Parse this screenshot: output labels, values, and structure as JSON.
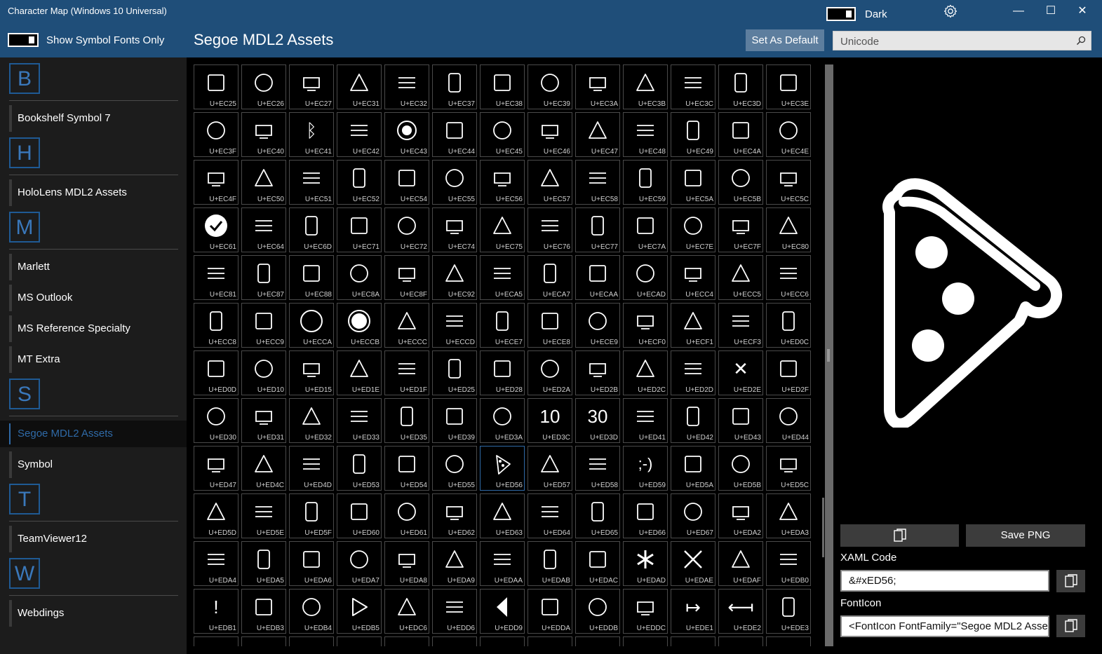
{
  "window": {
    "title": "Character Map (Windows 10 Universal)",
    "minimize": "—",
    "maximize": "☐",
    "close": "✕"
  },
  "theme": {
    "label": "Dark"
  },
  "toolbar": {
    "symbol_toggle_label": "Show Symbol Fonts Only",
    "current_font": "Segoe MDL2 Assets",
    "set_default_label": "Set As Default",
    "search_placeholder": "Unicode"
  },
  "sidebar": {
    "groups": [
      {
        "letter": "B",
        "fonts": [
          "Bookshelf Symbol 7"
        ]
      },
      {
        "letter": "H",
        "fonts": [
          "HoloLens MDL2 Assets"
        ]
      },
      {
        "letter": "M",
        "fonts": [
          "Marlett",
          "MS Outlook",
          "MS Reference Specialty",
          "MT Extra"
        ]
      },
      {
        "letter": "S",
        "fonts": [
          "Segoe MDL2 Assets",
          "Symbol"
        ]
      },
      {
        "letter": "T",
        "fonts": [
          "TeamViewer12"
        ]
      },
      {
        "letter": "W",
        "fonts": [
          "Webdings"
        ]
      }
    ],
    "selected_font": "Segoe MDL2 Assets"
  },
  "grid": {
    "selected_code": "U+ED56",
    "cells": [
      "U+EC25",
      "U+EC26",
      "U+EC27",
      "U+EC31",
      "U+EC32",
      "U+EC37",
      "U+EC38",
      "U+EC39",
      "U+EC3A",
      "U+EC3B",
      "U+EC3C",
      "U+EC3D",
      "U+EC3E",
      "U+EC3F",
      "U+EC40",
      "U+EC41",
      "U+EC42",
      "U+EC43",
      "U+EC44",
      "U+EC45",
      "U+EC46",
      "U+EC47",
      "U+EC48",
      "U+EC49",
      "U+EC4A",
      "U+EC4E",
      "U+EC4F",
      "U+EC50",
      "U+EC51",
      "U+EC52",
      "U+EC54",
      "U+EC55",
      "U+EC56",
      "U+EC57",
      "U+EC58",
      "U+EC59",
      "U+EC5A",
      "U+EC5B",
      "U+EC5C",
      "U+EC61",
      "U+EC64",
      "U+EC6D",
      "U+EC71",
      "U+EC72",
      "U+EC74",
      "U+EC75",
      "U+EC76",
      "U+EC77",
      "U+EC7A",
      "U+EC7E",
      "U+EC7F",
      "U+EC80",
      "U+EC81",
      "U+EC87",
      "U+EC88",
      "U+EC8A",
      "U+EC8F",
      "U+EC92",
      "U+ECA5",
      "U+ECA7",
      "U+ECAA",
      "U+ECAD",
      "U+ECC4",
      "U+ECC5",
      "U+ECC6",
      "U+ECC8",
      "U+ECC9",
      "U+ECCA",
      "U+ECCB",
      "U+ECCC",
      "U+ECCD",
      "U+ECE7",
      "U+ECE8",
      "U+ECE9",
      "U+ECF0",
      "U+ECF1",
      "U+ECF3",
      "U+ED0C",
      "U+ED0D",
      "U+ED10",
      "U+ED15",
      "U+ED1E",
      "U+ED1F",
      "U+ED25",
      "U+ED28",
      "U+ED2A",
      "U+ED2B",
      "U+ED2C",
      "U+ED2D",
      "U+ED2E",
      "U+ED2F",
      "U+ED30",
      "U+ED31",
      "U+ED32",
      "U+ED33",
      "U+ED35",
      "U+ED39",
      "U+ED3A",
      "U+ED3C",
      "U+ED3D",
      "U+ED41",
      "U+ED42",
      "U+ED43",
      "U+ED44",
      "U+ED47",
      "U+ED4C",
      "U+ED4D",
      "U+ED53",
      "U+ED54",
      "U+ED55",
      "U+ED56",
      "U+ED57",
      "U+ED58",
      "U+ED59",
      "U+ED5A",
      "U+ED5B",
      "U+ED5C",
      "U+ED5D",
      "U+ED5E",
      "U+ED5F",
      "U+ED60",
      "U+ED61",
      "U+ED62",
      "U+ED63",
      "U+ED64",
      "U+ED65",
      "U+ED66",
      "U+ED67",
      "U+EDA2",
      "U+EDA3",
      "U+EDA4",
      "U+EDA5",
      "U+EDA6",
      "U+EDA7",
      "U+EDA8",
      "U+EDA9",
      "U+EDAA",
      "U+EDAB",
      "U+EDAC",
      "U+EDAD",
      "U+EDAE",
      "U+EDAF",
      "U+EDB0",
      "U+EDB1",
      "U+EDB3",
      "U+EDB4",
      "U+EDB5",
      "U+EDC6",
      "U+EDD6",
      "U+EDD9",
      "U+EDDA",
      "U+EDDB",
      "U+EDDC",
      "U+EDE1",
      "U+EDE2",
      "U+EDE3"
    ],
    "glyph_icons": {
      "U+EC43": "radio-selected-icon",
      "U+ECCA": "circle-outline-icon",
      "U+ECCB": "circle-ring-icon",
      "U+EC61": "check-circle-icon",
      "U+ED56": "pizza-icon",
      "U+EDAD": "asterisk-icon",
      "U+EDAE": "close-icon",
      "U+EDB5": "play-outline-icon",
      "U+EDD9": "triangle-left-icon"
    },
    "glyph_text": {
      "U+ED3C": "10",
      "U+ED3D": "30",
      "U+ED59": ";-)",
      "U+ED2E": "✕",
      "U+EDB1": "!",
      "U+EDE1": "↦",
      "U+EDE2": "⟻",
      "U+EC41": "ᛒ"
    }
  },
  "preview": {
    "glyph_name": "pizza-icon",
    "save_png_label": "Save PNG",
    "xaml_label": "XAML Code",
    "xaml_value": "&#xED56;",
    "fonticon_label": "FontIcon",
    "fonticon_value": "<FontIcon FontFamily=\"Segoe MDL2 Asse"
  },
  "colors": {
    "titlebar": "#1f4e79",
    "accent": "#2f6aa7",
    "sidebar": "#1c1c1c"
  }
}
